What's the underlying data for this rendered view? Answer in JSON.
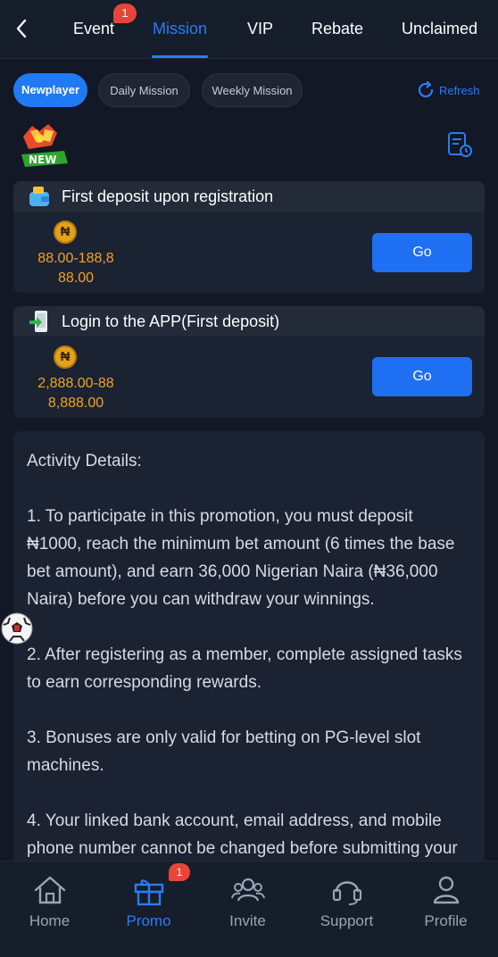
{
  "topnav": {
    "tabs": [
      {
        "label": "Event",
        "badge": "1"
      },
      {
        "label": "Mission"
      },
      {
        "label": "VIP"
      },
      {
        "label": "Rebate"
      },
      {
        "label": "Unclaimed"
      }
    ],
    "active_tab": "Mission"
  },
  "filters": {
    "chips": [
      "Newplayer",
      "Daily Mission",
      "Weekly Mission"
    ],
    "active": "Newplayer",
    "refresh_label": "Refresh"
  },
  "badge_text": "NEW",
  "tasks": [
    {
      "title": "First deposit upon registration",
      "currency_symbol": "₦",
      "reward_line1": "88.00-188,8",
      "reward_line2": "88.00",
      "button": "Go",
      "icon": "wallet-icon"
    },
    {
      "title": "Login to the APP(First deposit)",
      "currency_symbol": "₦",
      "reward_line1": "2,888.00-88",
      "reward_line2": "8,888.00",
      "button": "Go",
      "icon": "phone-login-icon"
    }
  ],
  "details": {
    "heading": "Activity Details:",
    "items": [
      "1. To participate in this promotion, you must deposit ₦1000, reach the minimum bet amount (6 times the base bet amount), and earn 36,000 Nigerian Naira (₦36,000 Naira) before you can withdraw your winnings.",
      "2. After registering as a member, complete assigned tasks to earn corresponding rewards.",
      "3. Bonuses are only valid for betting on PG-level slot machines.",
      "4. Your linked bank account, email address, and mobile phone number cannot be changed before submitting your"
    ]
  },
  "bottomnav": {
    "items": [
      {
        "label": "Home",
        "icon": "home-icon"
      },
      {
        "label": "Promo",
        "icon": "gift-icon",
        "badge": "1"
      },
      {
        "label": "Invite",
        "icon": "users-icon"
      },
      {
        "label": "Support",
        "icon": "headset-icon"
      },
      {
        "label": "Profile",
        "icon": "user-icon"
      }
    ],
    "active": "Promo"
  },
  "colors": {
    "accent": "#2a7cf6",
    "background": "#121826",
    "card": "#1b2231",
    "reward": "#f0a422",
    "badge": "#e8453a"
  }
}
